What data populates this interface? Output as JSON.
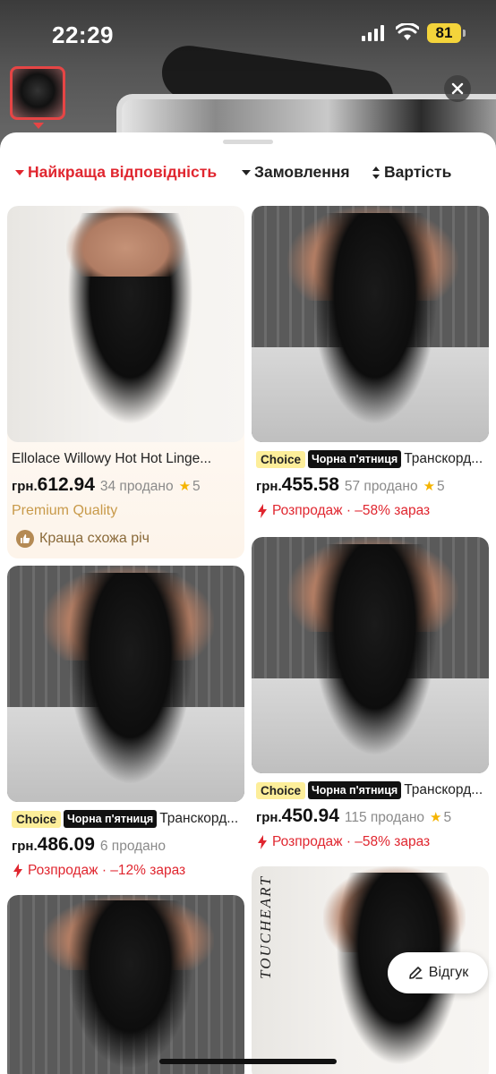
{
  "status_bar": {
    "time": "22:29",
    "battery": "81"
  },
  "sort": {
    "best_match": "Найкраща відповідність",
    "orders": "Замовлення",
    "price": "Вартість"
  },
  "products": [
    {
      "title": "Ellolace Willowy Hot Hot Linge...",
      "currency": "грн.",
      "price": "612.94",
      "sold": "34 продано",
      "rating": "5",
      "premium": "Premium Quality",
      "similar": "Краща схожа річ"
    },
    {
      "badge_choice": "Choice",
      "badge_friday": "Чорна п'ятниця",
      "title": "Транскорд...",
      "currency": "грн.",
      "price": "455.58",
      "sold": "57 продано",
      "rating": "5",
      "sale": "Розпродаж · –58% зараз"
    },
    {
      "badge_choice": "Choice",
      "badge_friday": "Чорна п'ятниця",
      "title": "Транскорд...",
      "currency": "грн.",
      "price": "486.09",
      "sold": "6 продано",
      "sale": "Розпродаж · –12% зараз"
    },
    {
      "badge_choice": "Choice",
      "badge_friday": "Чорна п'ятниця",
      "title": "Транскорд...",
      "currency": "грн.",
      "price": "450.94",
      "sold": "115 продано",
      "rating": "5",
      "sale": "Розпродаж · –58% зараз"
    },
    {
      "brand": "TOUCHEART"
    }
  ],
  "feedback": "Відгук",
  "colors": {
    "accent": "#e0262f",
    "choice": "#fdee9a",
    "premium": "#c89a4a"
  }
}
